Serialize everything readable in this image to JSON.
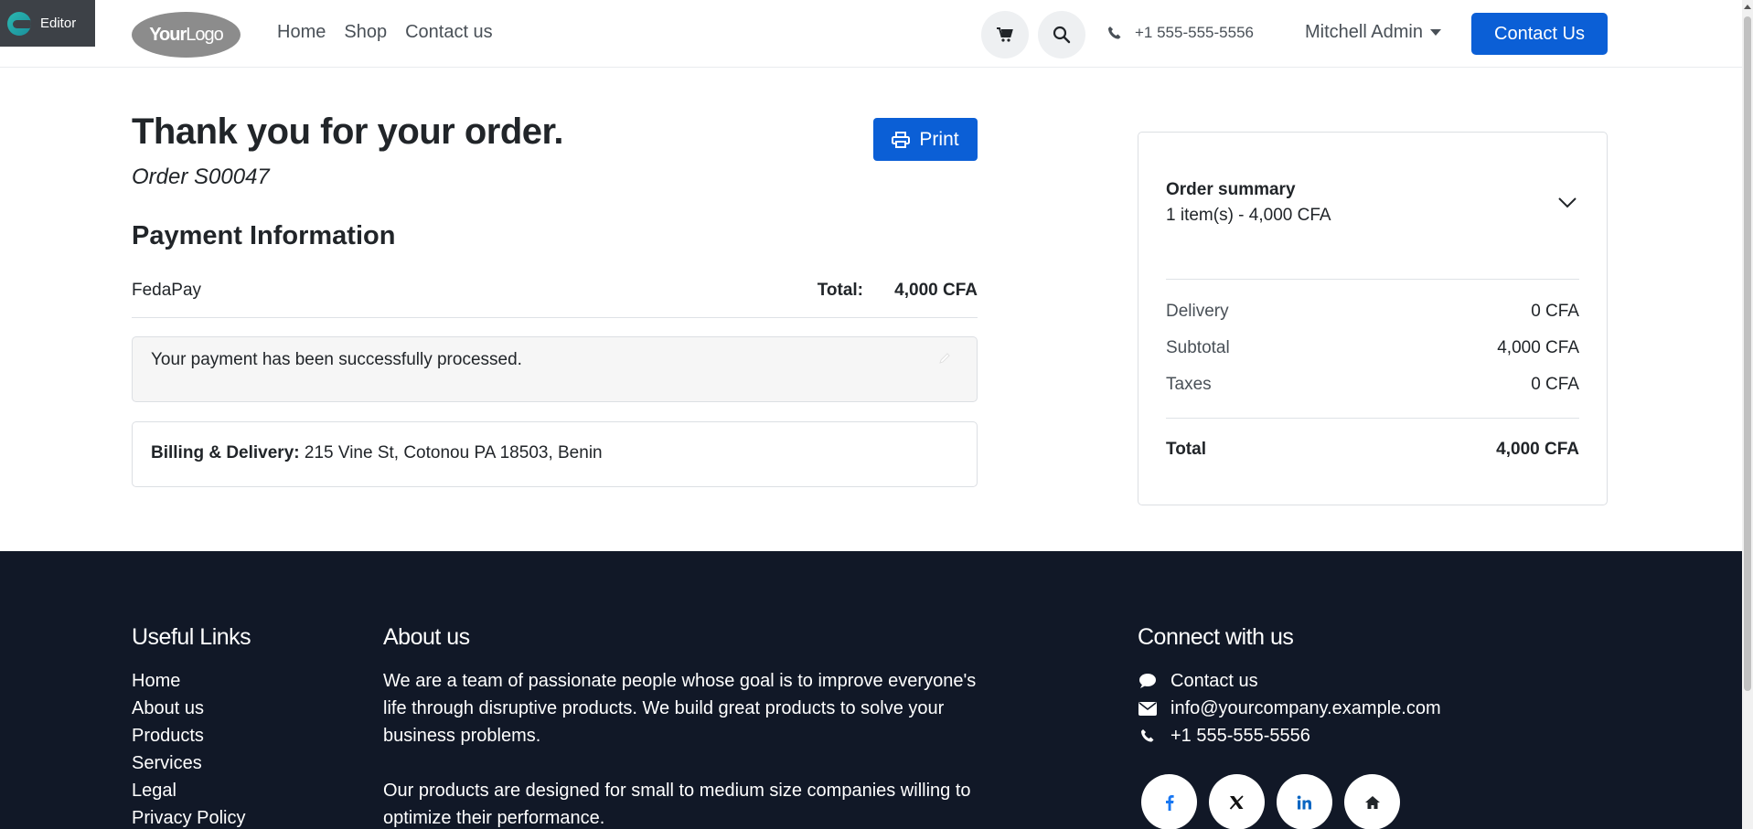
{
  "editor": {
    "label": "Editor"
  },
  "header": {
    "logo_text_bold": "Your",
    "logo_text_light": "Logo",
    "nav": [
      {
        "label": "Home"
      },
      {
        "label": "Shop"
      },
      {
        "label": "Contact us"
      }
    ],
    "phone": "+1 555-555-5556",
    "user": "Mitchell Admin",
    "contact_button": "Contact Us"
  },
  "confirmation": {
    "title": "Thank you for your order.",
    "order_ref": "Order S00047",
    "print_label": "Print",
    "payment_heading": "Payment Information",
    "payment_method": "FedaPay",
    "total_label": "Total:",
    "total_value": "4,000 CFA",
    "success_message": "Your payment has been successfully processed.",
    "billing_label": "Billing & Delivery:",
    "billing_address": " 215 Vine St, Cotonou PA 18503, Benin"
  },
  "summary": {
    "title": "Order summary",
    "items_text": "1 item(s) -  4,000 CFA",
    "lines": [
      {
        "label": "Delivery",
        "value": "0 CFA"
      },
      {
        "label": "Subtotal",
        "value": "4,000 CFA"
      },
      {
        "label": "Taxes",
        "value": "0 CFA"
      }
    ],
    "total_label": "Total",
    "total_value": "4,000 CFA"
  },
  "footer": {
    "links_heading": "Useful Links",
    "links": [
      {
        "label": "Home"
      },
      {
        "label": "About us"
      },
      {
        "label": "Products"
      },
      {
        "label": "Services"
      },
      {
        "label": "Legal"
      },
      {
        "label": "Privacy Policy"
      }
    ],
    "about_heading": "About us",
    "about_p1": "We are a team of passionate people whose goal is to improve everyone's life through disruptive products. We build great products to solve your business problems.",
    "about_p2": "Our products are designed for small to medium size companies willing to optimize their performance.",
    "connect_heading": "Connect with us",
    "connect": {
      "contact": "Contact us",
      "email": "info@yourcompany.example.com",
      "phone": "+1 555-555-5556"
    },
    "socials": [
      "facebook-icon",
      "x-twitter-icon",
      "linkedin-icon",
      "home-icon"
    ]
  },
  "colors": {
    "primary": "#0b5fd6",
    "footer_bg": "#111827",
    "linkedin": "#0a66c2",
    "facebook": "#1877f2"
  }
}
